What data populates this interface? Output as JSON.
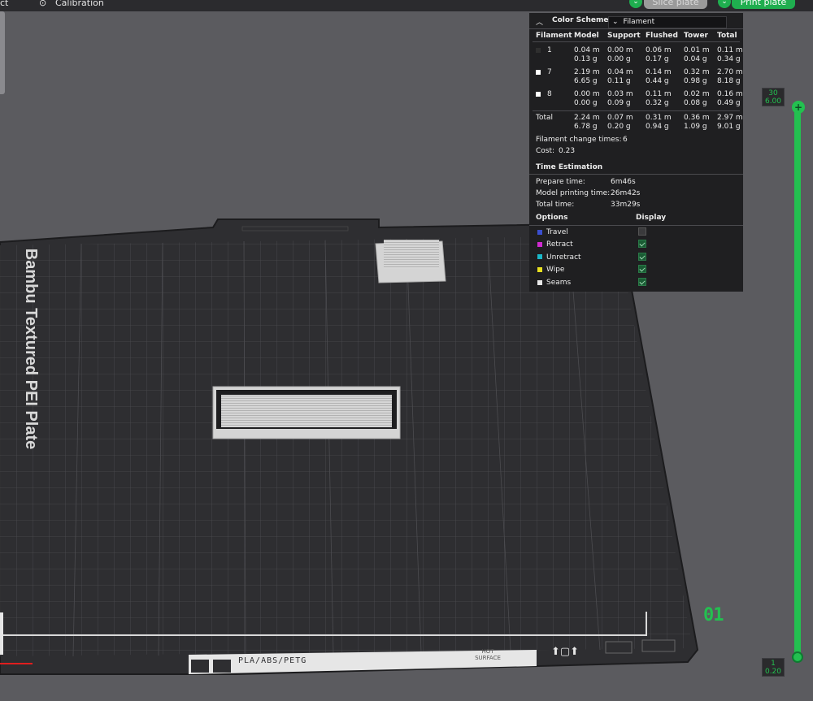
{
  "topbar": {
    "left_fragment": "ct",
    "calibration_label": "Calibration",
    "slice_plate_label": "Slice plate",
    "print_plate_label": "Print plate"
  },
  "panel": {
    "color_scheme_title": "Color Scheme",
    "color_scheme_value": "Filament",
    "headers": [
      "Filament",
      "Model",
      "Support",
      "Flushed",
      "Tower",
      "Total"
    ],
    "rows": [
      {
        "id": "1",
        "color": "#2f2f2f",
        "model": [
          "0.04 m",
          "0.13 g"
        ],
        "support": [
          "0.00 m",
          "0.00 g"
        ],
        "flushed": [
          "0.06 m",
          "0.17 g"
        ],
        "tower": [
          "0.01 m",
          "0.04 g"
        ],
        "total": [
          "0.11 m",
          "0.34 g"
        ]
      },
      {
        "id": "7",
        "color": "#ffffff",
        "model": [
          "2.19 m",
          "6.65 g"
        ],
        "support": [
          "0.04 m",
          "0.11 g"
        ],
        "flushed": [
          "0.14 m",
          "0.44 g"
        ],
        "tower": [
          "0.32 m",
          "0.98 g"
        ],
        "total": [
          "2.70 m",
          "8.18 g"
        ]
      },
      {
        "id": "8",
        "color": "#ffffff",
        "model": [
          "0.00 m",
          "0.00 g"
        ],
        "support": [
          "0.03 m",
          "0.09 g"
        ],
        "flushed": [
          "0.11 m",
          "0.32 g"
        ],
        "tower": [
          "0.02 m",
          "0.08 g"
        ],
        "total": [
          "0.16 m",
          "0.49 g"
        ]
      }
    ],
    "total_row": {
      "label": "Total",
      "model": [
        "2.24 m",
        "6.78 g"
      ],
      "support": [
        "0.07 m",
        "0.20 g"
      ],
      "flushed": [
        "0.31 m",
        "0.94 g"
      ],
      "tower": [
        "0.36 m",
        "1.09 g"
      ],
      "total": [
        "2.97 m",
        "9.01 g"
      ]
    },
    "filament_change_label": "Filament change times:",
    "filament_change_value": "6",
    "cost_label": "Cost:",
    "cost_value": "0.23",
    "time_title": "Time Estimation",
    "prepare_label": "Prepare time:",
    "prepare_value": "6m46s",
    "model_time_label": "Model printing time:",
    "model_time_value": "26m42s",
    "total_time_label": "Total time:",
    "total_time_value": "33m29s",
    "options_header": "Options",
    "display_header": "Display",
    "options": [
      {
        "label": "Travel",
        "color": "#3a4fd0",
        "checked": false
      },
      {
        "label": "Retract",
        "color": "#d02ad0",
        "checked": true
      },
      {
        "label": "Unretract",
        "color": "#1ab8c8",
        "checked": true
      },
      {
        "label": "Wipe",
        "color": "#e8e020",
        "checked": true
      },
      {
        "label": "Seams",
        "color": "#e8e8e8",
        "checked": true
      }
    ]
  },
  "slider": {
    "top_layer": "30",
    "top_height": "6.00",
    "bottom_layer": "1",
    "bottom_height": "0.20"
  },
  "plate": {
    "name": "Bambu Textured PEI Plate",
    "number": "01",
    "material_text": "PLA/ABS/PETG",
    "hot_surface_text": "HOT SURFACE"
  },
  "colors": {
    "accent_green": "#23c050",
    "background": "#5b5b5f",
    "bed": "#2e2e31"
  }
}
